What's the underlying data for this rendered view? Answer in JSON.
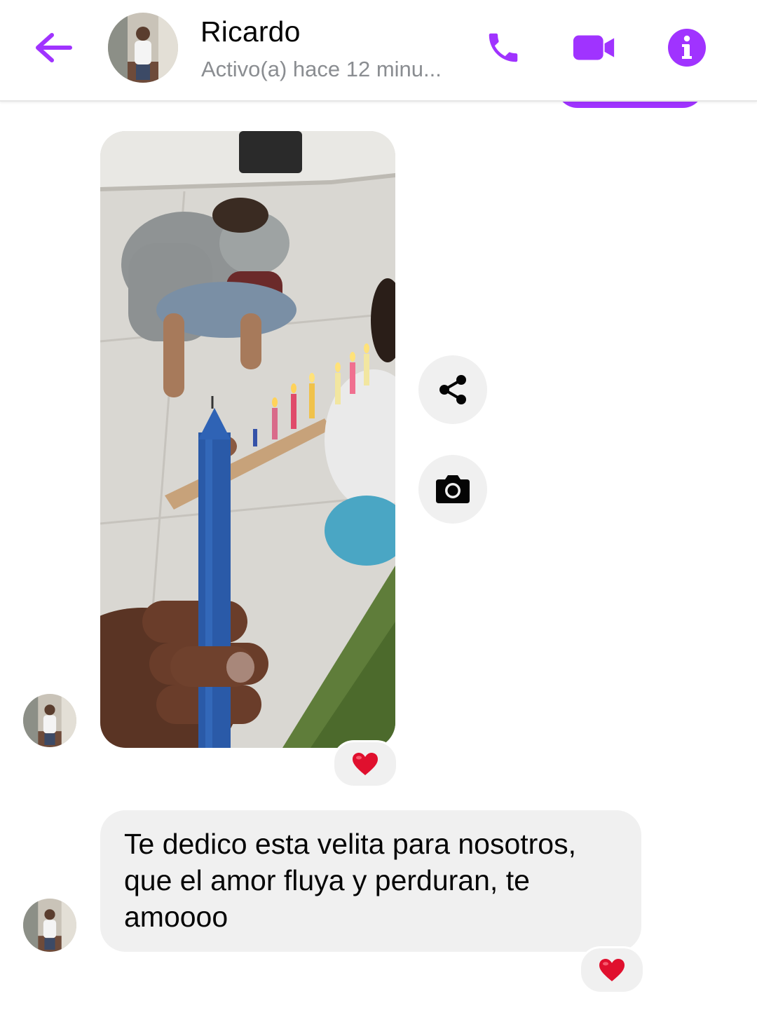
{
  "header": {
    "contact_name": "Ricardo",
    "status": "Activo(a) hace 12 minu...",
    "back_icon": "arrow-left-icon",
    "call_icon": "phone-icon",
    "video_icon": "video-camera-icon",
    "info_icon": "info-icon"
  },
  "colors": {
    "accent": "#a033ff",
    "bubble_gray": "#f0f0f0",
    "heart": "#e0102e"
  },
  "messages": [
    {
      "type": "photo",
      "description_icon": "photo-attachment",
      "actions": [
        "share-icon",
        "camera-icon"
      ],
      "reaction": "heart-icon"
    },
    {
      "type": "text",
      "text": "Te dedico esta velita para nosotros,\nque el amor fluya y perduran, te\namoooo",
      "reaction": "heart-icon"
    }
  ]
}
